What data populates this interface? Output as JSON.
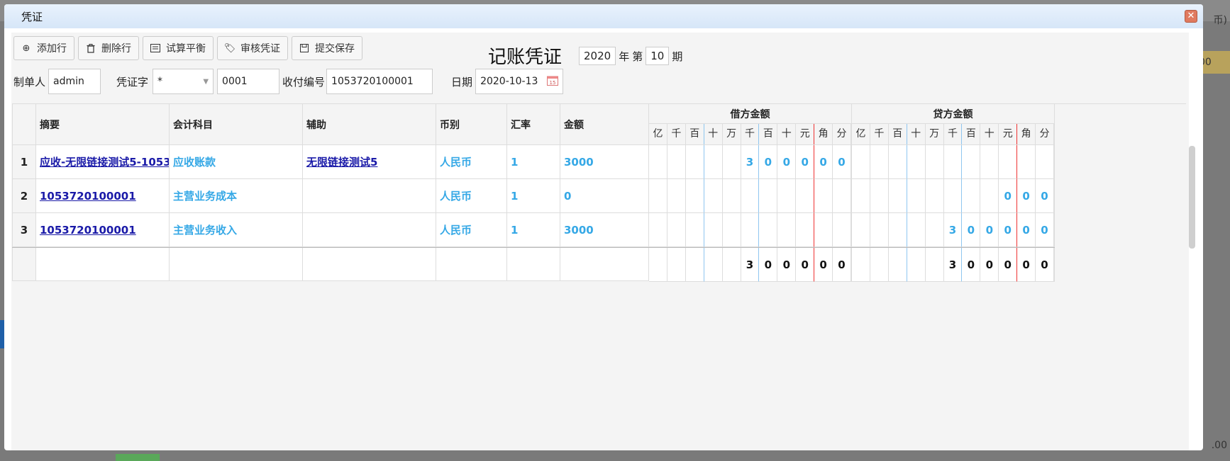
{
  "window": {
    "title": "凭证"
  },
  "toolbar": {
    "add_row": "添加行",
    "delete_row": "删除行",
    "trial_balance": "试算平衡",
    "audit": "审核凭证",
    "submit": "提交保存"
  },
  "voucher": {
    "title": "记账凭证",
    "year": "2020",
    "year_label": "年",
    "period_prefix": "第",
    "period": "10",
    "period_suffix": "期"
  },
  "form": {
    "maker_label": "制单人",
    "maker": "admin",
    "word_label": "凭证字",
    "word": "*",
    "number": "0001",
    "receipt_label": "收付编号",
    "receipt": "1053720100001",
    "date_label": "日期",
    "date": "2020-10-13"
  },
  "table": {
    "headers": {
      "summary": "摘要",
      "subject": "会计科目",
      "aux": "辅助",
      "currency": "币别",
      "rate": "汇率",
      "amount": "金额",
      "debit": "借方金额",
      "credit": "贷方金额"
    },
    "digit_units": [
      "亿",
      "千",
      "百",
      "十",
      "万",
      "千",
      "百",
      "十",
      "元",
      "角",
      "分"
    ],
    "rows": [
      {
        "no": "1",
        "summary": "应收-无限链接测试5-1053",
        "subject": "应收账款",
        "aux": "无限链接测试5",
        "currency": "人民币",
        "rate": "1",
        "amount": "3000",
        "debit": [
          "",
          "",
          "",
          "",
          "",
          "3",
          "0",
          "0",
          "0",
          "0",
          "0"
        ],
        "credit": [
          "",
          "",
          "",
          "",
          "",
          "",
          "",
          "",
          "",
          "",
          ""
        ]
      },
      {
        "no": "2",
        "summary": "1053720100001",
        "subject": "主营业务成本",
        "aux": "",
        "currency": "人民币",
        "rate": "1",
        "amount": "0",
        "debit": [
          "",
          "",
          "",
          "",
          "",
          "",
          "",
          "",
          "",
          "",
          ""
        ],
        "credit": [
          "",
          "",
          "",
          "",
          "",
          "",
          "",
          "",
          "0",
          "0",
          "0"
        ]
      },
      {
        "no": "3",
        "summary": "1053720100001",
        "subject": "主营业务收入",
        "aux": "",
        "currency": "人民币",
        "rate": "1",
        "amount": "3000",
        "debit": [
          "",
          "",
          "",
          "",
          "",
          "",
          "",
          "",
          "",
          "",
          ""
        ],
        "credit": [
          "",
          "",
          "",
          "",
          "",
          "3",
          "0",
          "0",
          "0",
          "0",
          "0"
        ]
      }
    ],
    "total": {
      "debit": [
        "",
        "",
        "",
        "",
        "",
        "3",
        "0",
        "0",
        "0",
        "0",
        "0"
      ],
      "credit": [
        "",
        "",
        "",
        "",
        "",
        "3",
        "0",
        "0",
        "0",
        "0",
        "0"
      ]
    }
  },
  "background": {
    "right_top": "币)",
    "gold_cell": "00",
    "right_bottom": ".00"
  }
}
